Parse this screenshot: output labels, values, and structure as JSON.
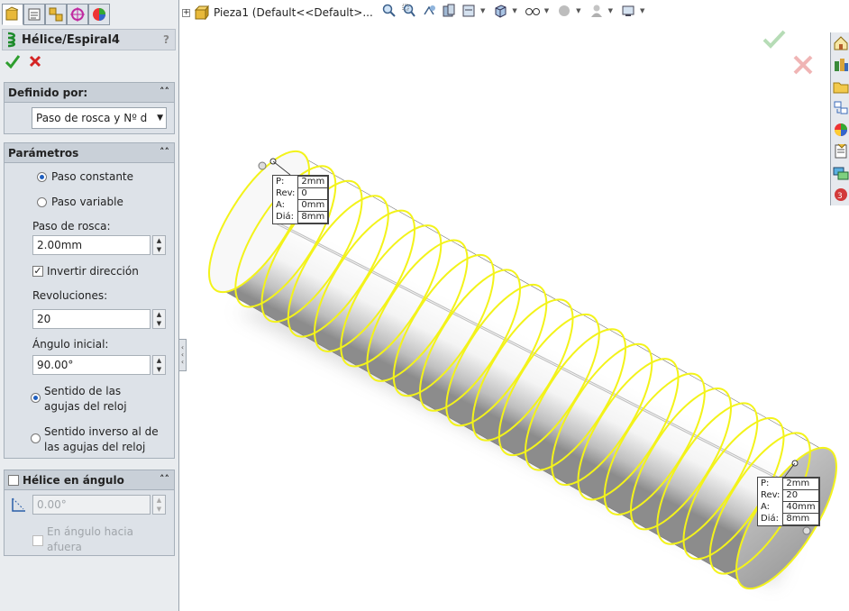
{
  "property_manager": {
    "title": "Hélice/Espiral4",
    "help": "?",
    "defined_by": {
      "heading": "Definido por:",
      "selected": "Paso de rosca y Nº d"
    },
    "params": {
      "heading": "Parámetros",
      "constant_pitch": "Paso constante",
      "variable_pitch": "Paso variable",
      "pitch_label": "Paso de rosca:",
      "pitch_value": "2.00mm",
      "reverse_direction": "Invertir dirección",
      "revolutions_label": "Revoluciones:",
      "revolutions_value": "20",
      "start_angle_label": "Ángulo inicial:",
      "start_angle_value": "90.00°",
      "clockwise_line1": "Sentido de las",
      "clockwise_line2": "agujas del reloj",
      "counterclockwise_line1": "Sentido inverso al de",
      "counterclockwise_line2": "las agujas del reloj"
    },
    "taper": {
      "heading": "Hélice en ángulo",
      "angle_value": "0.00°",
      "outward_line1": "En ángulo hacia",
      "outward_line2": "afuera"
    }
  },
  "tree": {
    "label": "Pieza1  (Default<<Default>..."
  },
  "callout_start": {
    "p_label": "P:",
    "p": "2mm",
    "rev_label": "Rev:",
    "rev": "0",
    "a_label": "A:",
    "a": "0mm",
    "dia_label": "Diá:",
    "dia": "8mm"
  },
  "callout_end": {
    "p_label": "P:",
    "p": "2mm",
    "rev_label": "Rev:",
    "rev": "20",
    "a_label": "A:",
    "a": "40mm",
    "dia_label": "Diá:",
    "dia": "8mm"
  },
  "colors": {
    "helix": "#f3f31a",
    "ok": "#2e9e2e",
    "cancel": "#d42424",
    "accent": "#1f5fbf"
  }
}
